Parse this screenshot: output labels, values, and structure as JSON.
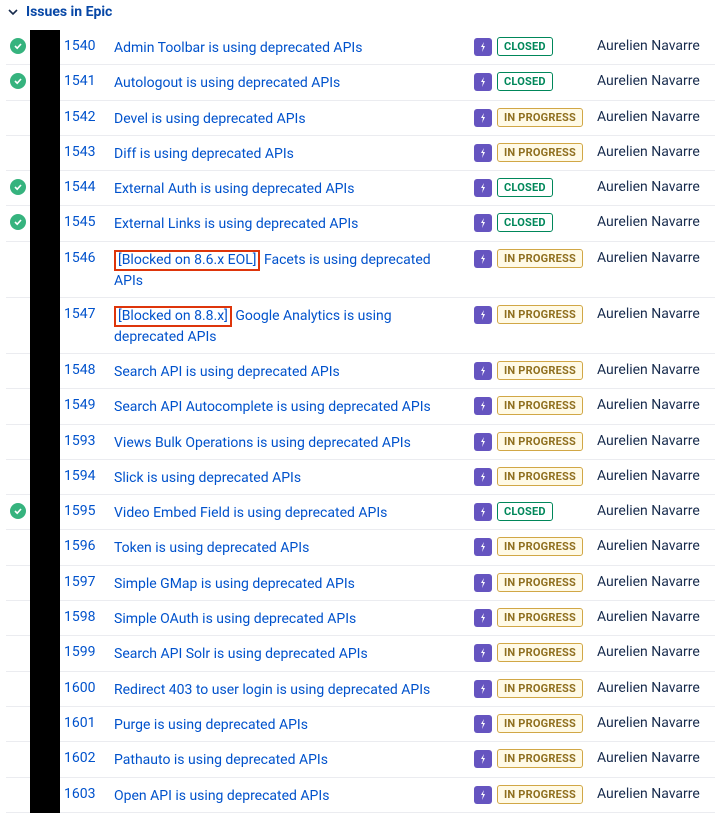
{
  "header": {
    "title": "Issues in Epic"
  },
  "assignee": "Aurelien Navarre",
  "status_labels": {
    "CLOSED": "CLOSED",
    "IN_PROGRESS": "IN PROGRESS"
  },
  "issues": [
    {
      "done": true,
      "key": "1540",
      "summary": "Admin Toolbar is using deprecated APIs",
      "status": "CLOSED"
    },
    {
      "done": true,
      "key": "1541",
      "summary": "Autologout is using deprecated APIs",
      "status": "CLOSED"
    },
    {
      "done": false,
      "key": "1542",
      "summary": "Devel is using deprecated APIs",
      "status": "IN_PROGRESS"
    },
    {
      "done": false,
      "key": "1543",
      "summary": "Diff is using deprecated APIs",
      "status": "IN_PROGRESS"
    },
    {
      "done": true,
      "key": "1544",
      "summary": "External Auth is using deprecated APIs",
      "status": "CLOSED"
    },
    {
      "done": true,
      "key": "1545",
      "summary": "External Links is using deprecated APIs",
      "status": "CLOSED"
    },
    {
      "done": false,
      "key": "1546",
      "prefix": "[Blocked on 8.6.x EOL]",
      "summary_after": " Facets is using deprecated APIs",
      "status": "IN_PROGRESS",
      "highlight": true
    },
    {
      "done": false,
      "key": "1547",
      "prefix": "[Blocked on 8.8.x]",
      "summary_after": " Google Analytics is using deprecated APIs",
      "status": "IN_PROGRESS",
      "highlight": true
    },
    {
      "done": false,
      "key": "1548",
      "summary": "Search API is using deprecated APIs",
      "status": "IN_PROGRESS"
    },
    {
      "done": false,
      "key": "1549",
      "summary": "Search API Autocomplete is using deprecated APIs",
      "status": "IN_PROGRESS"
    },
    {
      "done": false,
      "key": "1593",
      "summary": "Views Bulk Operations is using deprecated APIs",
      "status": "IN_PROGRESS"
    },
    {
      "done": false,
      "key": "1594",
      "summary": "Slick is using deprecated APIs",
      "status": "IN_PROGRESS"
    },
    {
      "done": true,
      "key": "1595",
      "summary": "Video Embed Field is using deprecated APIs",
      "status": "CLOSED"
    },
    {
      "done": false,
      "key": "1596",
      "summary": "Token is using deprecated APIs",
      "status": "IN_PROGRESS"
    },
    {
      "done": false,
      "key": "1597",
      "summary": "Simple GMap is using deprecated APIs",
      "status": "IN_PROGRESS"
    },
    {
      "done": false,
      "key": "1598",
      "summary": "Simple OAuth is using deprecated APIs",
      "status": "IN_PROGRESS"
    },
    {
      "done": false,
      "key": "1599",
      "summary": "Search API Solr is using deprecated APIs",
      "status": "IN_PROGRESS"
    },
    {
      "done": false,
      "key": "1600",
      "summary": "Redirect 403 to user login is using deprecated APIs",
      "status": "IN_PROGRESS"
    },
    {
      "done": false,
      "key": "1601",
      "summary": "Purge is using deprecated APIs",
      "status": "IN_PROGRESS"
    },
    {
      "done": false,
      "key": "1602",
      "summary": "Pathauto is using deprecated APIs",
      "status": "IN_PROGRESS"
    },
    {
      "done": false,
      "key": "1603",
      "summary": "Open API is using deprecated APIs",
      "status": "IN_PROGRESS"
    }
  ]
}
